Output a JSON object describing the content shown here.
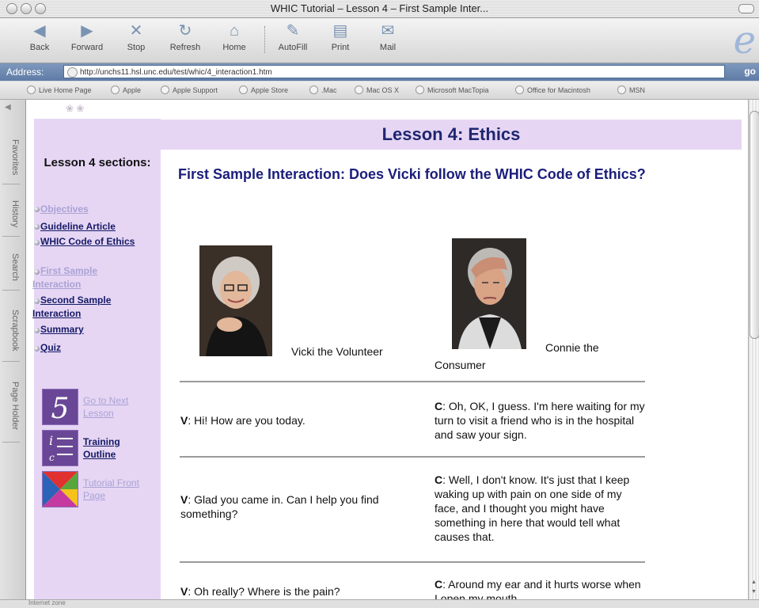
{
  "window": {
    "title": "WHIC Tutorial – Lesson 4 – First Sample Inter..."
  },
  "toolbar": {
    "buttons": [
      {
        "label": "Back",
        "icon": "back-arrow-icon"
      },
      {
        "label": "Forward",
        "icon": "forward-arrow-icon"
      },
      {
        "label": "Stop",
        "icon": "stop-x-icon"
      },
      {
        "label": "Refresh",
        "icon": "refresh-icon"
      },
      {
        "label": "Home",
        "icon": "home-icon"
      },
      {
        "label": "AutoFill",
        "icon": "autofill-icon"
      },
      {
        "label": "Print",
        "icon": "print-icon"
      },
      {
        "label": "Mail",
        "icon": "mail-icon"
      }
    ]
  },
  "address": {
    "label": "Address:",
    "url": "http://unchs11.hsl.unc.edu/test/whic/4_interaction1.htm",
    "go_label": "go"
  },
  "favorites": [
    "Live Home Page",
    "Apple",
    "Apple Support",
    "Apple Store",
    ".Mac",
    "Mac OS X",
    "Microsoft MacTopia",
    "Office for Macintosh",
    "MSN"
  ],
  "side_tabs": [
    "Favorites",
    "History",
    "Search",
    "Scrapbook",
    "Page Holder"
  ],
  "page": {
    "banner_title": "Lesson 4: Ethics",
    "sections_title": "Lesson 4 sections:",
    "sections": [
      {
        "label": "Objectives",
        "visited": true
      },
      {
        "label": "Guideline Article",
        "visited": false
      },
      {
        "label": "WHIC Code of Ethics",
        "visited": false
      },
      {
        "label": "First Sample Interaction",
        "visited": true
      },
      {
        "label": "Second Sample Interaction",
        "visited": false
      },
      {
        "label": "Summary",
        "visited": false
      },
      {
        "label": "Quiz",
        "visited": false
      }
    ],
    "bottom_nav": [
      {
        "label": "Go to Next Lesson",
        "icon": "next-lesson-icon",
        "visited": true
      },
      {
        "label": "Training Outline",
        "icon": "training-outline-icon",
        "visited": false
      },
      {
        "label": "Tutorial Front Page",
        "icon": "tutorial-front-page-icon",
        "visited": true
      }
    ],
    "heading": "First Sample Interaction: Does Vicki follow the WHIC Code of Ethics?",
    "people": [
      {
        "caption": "Vicki the Volunteer"
      },
      {
        "caption": "Connie the Consumer"
      }
    ],
    "dialogue": [
      {
        "speaker": "V",
        "text": ": Hi! How are you today."
      },
      {
        "speaker": "C",
        "text": ": Oh, OK, I guess. I'm here waiting for my turn to visit a friend who is in the hospital and saw your sign."
      },
      {
        "speaker": "V",
        "text": ": Glad you came in. Can I help you find something?"
      },
      {
        "speaker": "C",
        "text": ": Well, I don't know. It's just that I keep waking up with pain on one side of my face, and I thought you might have something in here that would tell what causes that."
      },
      {
        "speaker": "V",
        "text": ": Oh really? Where is the pain?"
      },
      {
        "speaker": "C",
        "text": ": Around my ear and it hurts worse when I open my mouth."
      }
    ]
  },
  "status": {
    "zone": "Internet zone"
  },
  "colors": {
    "nav_bg": "#e6d6f4",
    "heading": "#1b1e7a",
    "link": "#141a66",
    "visited_link": "#a9a2d4"
  }
}
